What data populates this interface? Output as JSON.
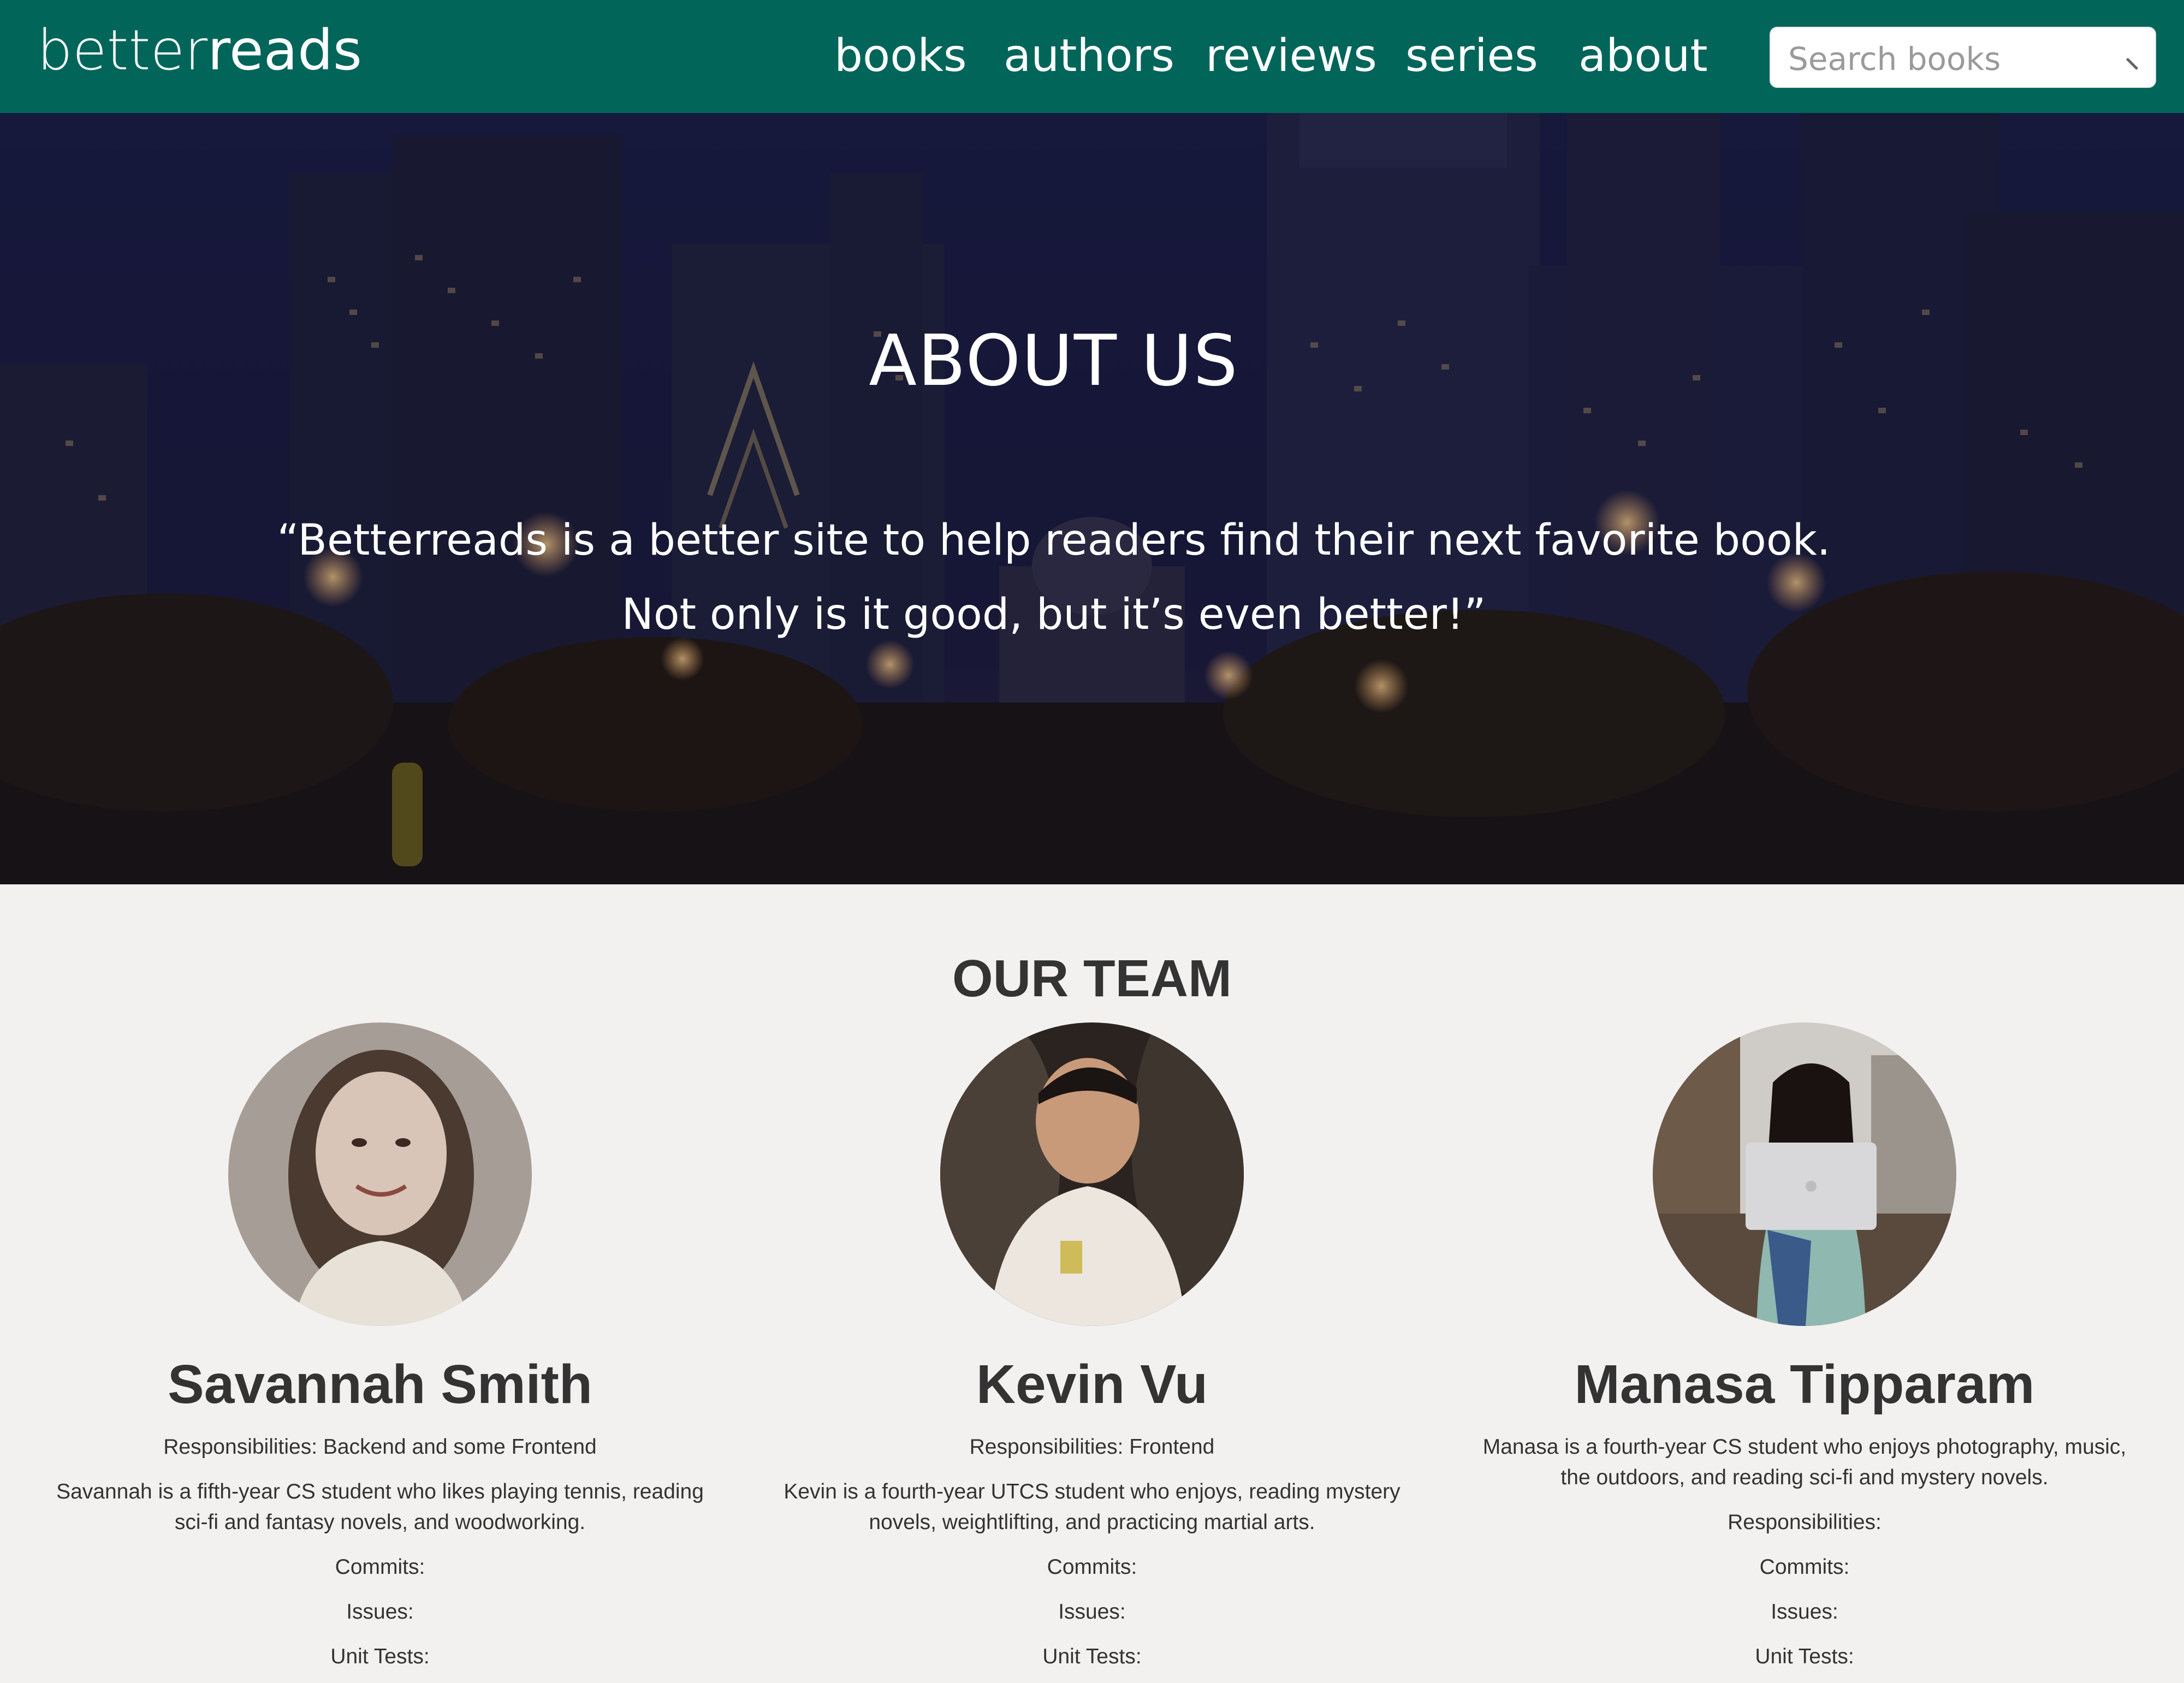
{
  "navbar": {
    "brand_light": "better",
    "brand_bold": "reads",
    "links": [
      "books",
      "authors",
      "reviews",
      "series",
      "about"
    ],
    "search_placeholder": "Search books"
  },
  "hero": {
    "title": "ABOUT US",
    "quote_line1": "“Betterreads is a better site to help readers find their next favorite book.",
    "quote_line2": "Not only is it good, but it’s even better!”"
  },
  "team": {
    "title": "OUR TEAM",
    "members": [
      {
        "name": "Savannah Smith",
        "responsibilities": "Responsibilities: Backend and some Frontend",
        "bio": "Savannah is a fifth-year CS student who likes playing tennis, reading sci-fi and fantasy novels, and woodworking.",
        "commits": "Commits:",
        "issues": "Issues:",
        "unit_tests": "Unit Tests:"
      },
      {
        "name": "Kevin Vu",
        "responsibilities": "Responsibilities: Frontend",
        "bio": "Kevin is a fourth-year UTCS student who enjoys, reading mystery novels, weightlifting, and practicing martial arts.",
        "commits": "Commits:",
        "issues": "Issues:",
        "unit_tests": "Unit Tests:"
      },
      {
        "name": "Manasa Tipparam",
        "bio": "Manasa is a fourth-year CS student who enjoys photography, music, the outdoors, and reading sci-fi and mystery novels.",
        "responsibilities": "Responsibilities:",
        "commits": "Commits:",
        "issues": "Issues:",
        "unit_tests": "Unit Tests:"
      }
    ]
  },
  "colors": {
    "navbar_bg": "#02655a",
    "page_bg": "#f2f1ef",
    "text_dark": "#333333",
    "hero_overlay": "#141634"
  },
  "icons": {
    "search": "search-icon"
  }
}
